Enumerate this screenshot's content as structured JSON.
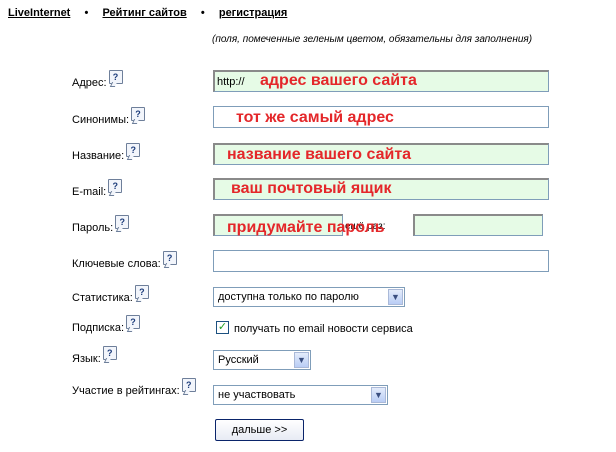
{
  "nav": {
    "items": [
      "LiveInternet",
      "Рейтинг сайтов",
      "регистрация"
    ],
    "separator": "•"
  },
  "note": "(поля, помеченные зеленым цветом, обязательны для заполнения)",
  "help_glyph": "?",
  "fields": {
    "address": {
      "label": "Адрес:",
      "prefix": "http://",
      "hint": "адрес вашего сайта",
      "required": true
    },
    "synonyms": {
      "label": "Синонимы:",
      "hint": "тот же самый адрес",
      "required": false
    },
    "name": {
      "label": "Название:",
      "hint": "название вашего сайта",
      "required": true
    },
    "email": {
      "label": "E-mail:",
      "hint": "ваш почтовый ящик",
      "required": true
    },
    "password": {
      "label": "Пароль:",
      "hint": "придумайте пароль",
      "repeat_label": "ещё раз:",
      "required": true
    },
    "keywords": {
      "label": "Ключевые слова:",
      "required": false
    },
    "statistics": {
      "label": "Статистика:",
      "selected": "доступна только по паролю"
    },
    "subscription": {
      "label": "Подписка:",
      "checkbox_label": "получать по email новости сервиса",
      "checked": true,
      "check_glyph": "✓"
    },
    "language": {
      "label": "Язык:",
      "selected": "Русский"
    },
    "ratings": {
      "label": "Участие в рейтингах:",
      "selected": "не участвовать"
    }
  },
  "dropdown_glyph": "▼",
  "submit_label": "дальше >>"
}
